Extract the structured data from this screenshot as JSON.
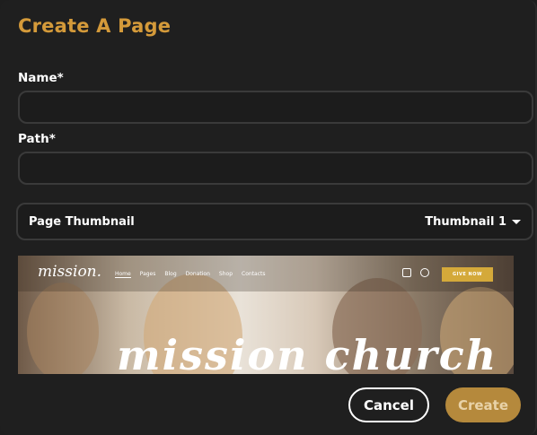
{
  "dialog": {
    "title": "Create A Page",
    "name_label": "Name*",
    "name_value": "",
    "path_label": "Path*",
    "path_value": "",
    "thumbnail_label": "Page Thumbnail",
    "thumbnail_selected": "Thumbnail 1",
    "cancel_label": "Cancel",
    "create_label": "Create"
  },
  "preview": {
    "logo": "mission.",
    "nav_links": [
      "Home",
      "Pages",
      "Blog",
      "Donation",
      "Shop",
      "Contacts"
    ],
    "give_button": "GIVE NOW",
    "headline": "mission church",
    "icons": [
      "bag-icon",
      "search-icon"
    ]
  },
  "colors": {
    "accent": "#d49a3a",
    "create_button": "#b5893c",
    "background": "#1f1f1f",
    "field_border": "#3a3a3a",
    "give_button": "#d4a93a"
  }
}
